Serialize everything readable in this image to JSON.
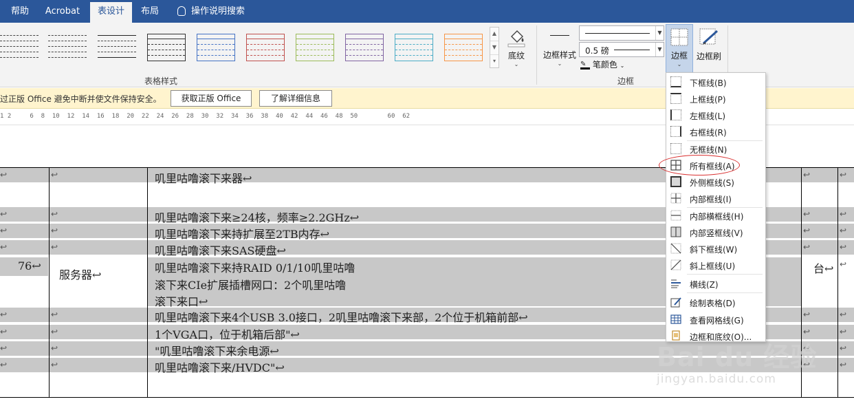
{
  "tabs": [
    {
      "label": "帮助"
    },
    {
      "label": "Acrobat"
    },
    {
      "label": "表设计"
    },
    {
      "label": "布局"
    }
  ],
  "tell_me": "操作说明搜索",
  "ribbon": {
    "table_styles_label": "表格样式",
    "shading_label": "底纹",
    "border_styles_label": "边框样式",
    "pen_weight": "0.5 磅",
    "pen_color_label": "笔颜色",
    "borders_label": "边框",
    "borders_group_label": "边框",
    "border_painter_label": "边框刷"
  },
  "message_bar": {
    "text": "过正版 Office 避免中断并使文件保持安全。",
    "get_office_button": "获取正版 Office",
    "learn_more_button": "了解详细信息"
  },
  "ruler": {
    "text": "1 2     6  8  10  12  14  16  18  20  22  24  26  28  30  32  34  36  38  40  42  44  46  48  50        60  62"
  },
  "table": {
    "number_cell": "76↩",
    "name_cell": "服务器↩",
    "unit_cell": "台↩",
    "rows": [
      "叽里咕噜滚下来器↩",
      "叽里咕噜滚下来≥24核，频率≥2.2GHz↩",
      "叽里咕噜滚下来持扩展至2TB内存↩",
      "叽里咕噜滚下来SAS硬盘↩",
      "叽里咕噜滚下来持RAID 0/1/10叽里咕噜",
      "滚下来CIe扩展插槽网口：2个叽里咕噜",
      "滚下来口↩",
      "叽里咕噜滚下来4个USB 3.0接口，2叽里咕噜滚下来部，2个位于机箱前部↩",
      "1个VGA口，位于机箱后部\"↩",
      "\"叽里咕噜滚下来余电源↩",
      "叽里咕噜滚下来/HVDC\"↩"
    ],
    "mark": "↩"
  },
  "borders_menu": [
    {
      "label": "下框线(B)",
      "icon": "bottom-border-icon"
    },
    {
      "label": "上框线(P)",
      "icon": "top-border-icon"
    },
    {
      "label": "左框线(L)",
      "icon": "left-border-icon"
    },
    {
      "label": "右框线(R)",
      "icon": "right-border-icon"
    },
    {
      "label": "无框线(N)",
      "icon": "no-border-icon"
    },
    {
      "label": "所有框线(A)",
      "icon": "all-borders-icon"
    },
    {
      "label": "外侧框线(S)",
      "icon": "outside-borders-icon"
    },
    {
      "label": "内部框线(I)",
      "icon": "inside-borders-icon"
    },
    {
      "label": "内部横框线(H)",
      "icon": "inside-horizontal-border-icon"
    },
    {
      "label": "内部竖框线(V)",
      "icon": "inside-vertical-border-icon"
    },
    {
      "label": "斜下框线(W)",
      "icon": "diagonal-down-border-icon"
    },
    {
      "label": "斜上框线(U)",
      "icon": "diagonal-up-border-icon"
    },
    {
      "label": "横线(Z)",
      "icon": "horizontal-line-icon"
    },
    {
      "label": "绘制表格(D)",
      "icon": "draw-table-icon"
    },
    {
      "label": "查看网格线(G)",
      "icon": "view-gridlines-icon"
    },
    {
      "label": "边框和底纹(O)...",
      "icon": "borders-shading-icon"
    }
  ],
  "watermark": {
    "brand": "Bai du 经验",
    "url": "jingyan.baidu.com"
  },
  "colors": {
    "ribbon_blue": "#2b579a",
    "message_bar": "#fff4ce",
    "cell_shading": "#c8c8c8",
    "highlight_circle": "#d93030"
  }
}
